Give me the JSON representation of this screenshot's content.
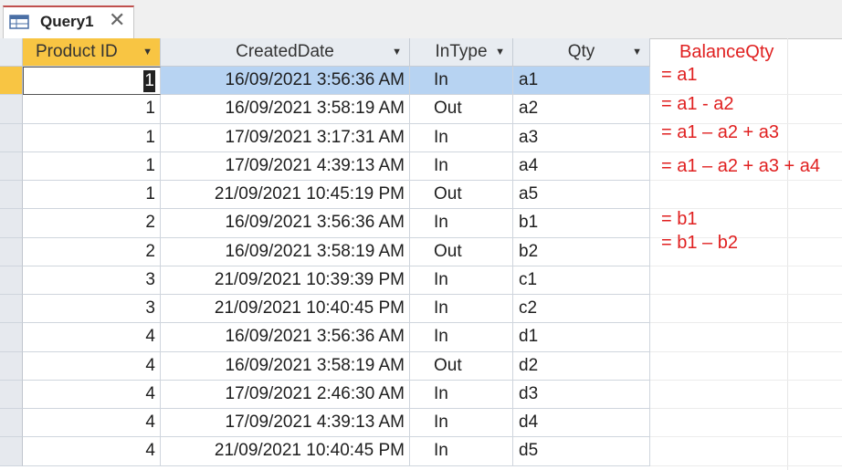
{
  "tab": {
    "title": "Query1",
    "icon": "query-datasheet-icon"
  },
  "columns": [
    {
      "label": "Product ID",
      "highlight": true
    },
    {
      "label": "CreatedDate"
    },
    {
      "label": "InType"
    },
    {
      "label": "Qty"
    }
  ],
  "annotations_header": "BalanceQty",
  "rows": [
    {
      "pid": "1",
      "date": "16/09/2021 3:56:36 AM",
      "type": "In",
      "qty": "a1",
      "note": "= a1"
    },
    {
      "pid": "1",
      "date": "16/09/2021 3:58:19 AM",
      "type": "Out",
      "qty": "a2",
      "note": "= a1 - a2"
    },
    {
      "pid": "1",
      "date": "17/09/2021 3:17:31 AM",
      "type": "In",
      "qty": "a3",
      "note": "= a1 – a2 + a3"
    },
    {
      "pid": "1",
      "date": "17/09/2021 4:39:13 AM",
      "type": "In",
      "qty": "a4",
      "note": "= a1 – a2 + a3 + a4"
    },
    {
      "pid": "1",
      "date": "21/09/2021 10:45:19 PM",
      "type": "Out",
      "qty": "a5",
      "note": ""
    },
    {
      "pid": "2",
      "date": "16/09/2021 3:56:36 AM",
      "type": "In",
      "qty": "b1",
      "note": "= b1"
    },
    {
      "pid": "2",
      "date": "16/09/2021 3:58:19 AM",
      "type": "Out",
      "qty": "b2",
      "note": "= b1 – b2"
    },
    {
      "pid": "3",
      "date": "21/09/2021 10:39:39 PM",
      "type": "In",
      "qty": "c1",
      "note": ""
    },
    {
      "pid": "3",
      "date": "21/09/2021 10:40:45 PM",
      "type": "In",
      "qty": "c2",
      "note": ""
    },
    {
      "pid": "4",
      "date": "16/09/2021 3:56:36 AM",
      "type": "In",
      "qty": "d1",
      "note": ""
    },
    {
      "pid": "4",
      "date": "16/09/2021 3:58:19 AM",
      "type": "Out",
      "qty": "d2",
      "note": ""
    },
    {
      "pid": "4",
      "date": "17/09/2021 2:46:30 AM",
      "type": "In",
      "qty": "d3",
      "note": ""
    },
    {
      "pid": "4",
      "date": "17/09/2021 4:39:13 AM",
      "type": "In",
      "qty": "d4",
      "note": ""
    },
    {
      "pid": "4",
      "date": "21/09/2021 10:40:45 PM",
      "type": "In",
      "qty": "d5",
      "note": ""
    }
  ],
  "colors": {
    "current_row": "#b7d3f2",
    "annotation": "#e02020",
    "header_highlight": "#f8c543"
  }
}
